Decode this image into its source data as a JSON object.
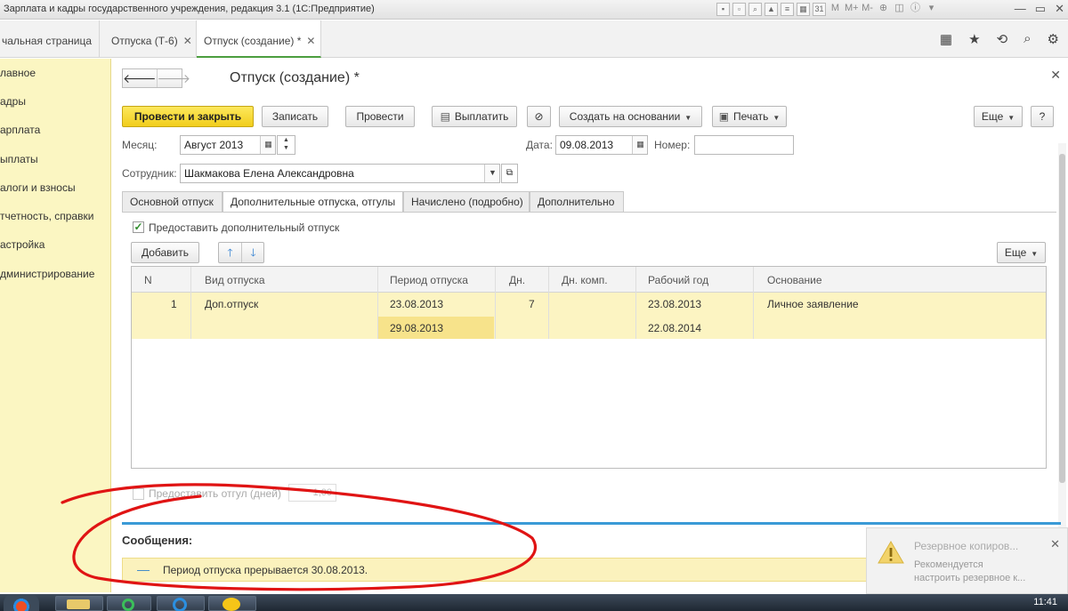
{
  "window": {
    "title": "Зарплата и кадры государственного учреждения, редакция 3.1  (1С:Предприятие)",
    "toolbar_icons": [
      "save-icon",
      "print-icon",
      "preview-icon",
      "upload-icon",
      "document-icon",
      "table-icon",
      "calendar-icon"
    ],
    "memory": [
      "M",
      "M+",
      "M-"
    ]
  },
  "tabs": [
    {
      "label": "чальная страница"
    },
    {
      "label": "Отпуска (Т-6)"
    },
    {
      "label": "Отпуск (создание) *"
    }
  ],
  "sidebar": {
    "items": [
      {
        "label": "лавное"
      },
      {
        "label": "адры"
      },
      {
        "label": "арплата"
      },
      {
        "label": "ыплаты"
      },
      {
        "label": "алоги и взносы"
      },
      {
        "label": "тчетность, справки"
      },
      {
        "label": "астройка"
      },
      {
        "label": "дминистрирование"
      }
    ]
  },
  "form": {
    "title": "Отпуск (создание) *",
    "buttons": {
      "post_close": "Провести и закрыть",
      "write": "Записать",
      "post": "Провести",
      "pay": "Выплатить",
      "create_based": "Создать на основании",
      "print": "Печать",
      "more": "Еще",
      "help": "?"
    },
    "month_label": "Месяц:",
    "month_value": "Август 2013",
    "date_label": "Дата:",
    "date_value": "09.08.2013",
    "number_label": "Номер:",
    "number_value": "",
    "employee_label": "Сотрудник:",
    "employee_value": "Шакмакова Елена Александровна",
    "inner_tabs": [
      {
        "label": "Основной отпуск"
      },
      {
        "label": "Дополнительные отпуска, отгулы"
      },
      {
        "label": "Начислено (подробно)"
      },
      {
        "label": "Дополнительно"
      }
    ],
    "extra_leave_checkbox": "Предоставить дополнительный отпуск",
    "add_button": "Добавить",
    "table_more": "Еще",
    "table": {
      "columns": [
        "N",
        "Вид отпуска",
        "Период отпуска",
        "Дн.",
        "Дн. комп.",
        "Рабочий год",
        "Основание"
      ],
      "rows": [
        {
          "n": "1",
          "type": "Доп.отпуск",
          "period_from": "23.08.2013",
          "period_to": "29.08.2013",
          "days": "7",
          "comp_days": "",
          "work_year_from": "23.08.2013",
          "work_year_to": "22.08.2014",
          "reason": "Личное заявление"
        }
      ]
    },
    "dayoff_checkbox": "Предоставить отгул (дней)",
    "dayoff_value": "1,00"
  },
  "messages": {
    "title": "Сообщения:",
    "items": [
      "Период отпуска прерывается 30.08.2013."
    ]
  },
  "notification": {
    "title": "Резервное копиров...",
    "line1": "Рекомендуется",
    "line2": "настроить резервное к..."
  },
  "taskbar": {
    "clock": "11:41"
  },
  "colors": {
    "sidebar_bg": "#fbf6c2",
    "primary_button": "#f1cd1c",
    "active_tab_underline": "#4c9e3f",
    "selected_row": "#fcf4c2",
    "messages_bar": "#3a9ad6",
    "annotation": "#e01414"
  }
}
